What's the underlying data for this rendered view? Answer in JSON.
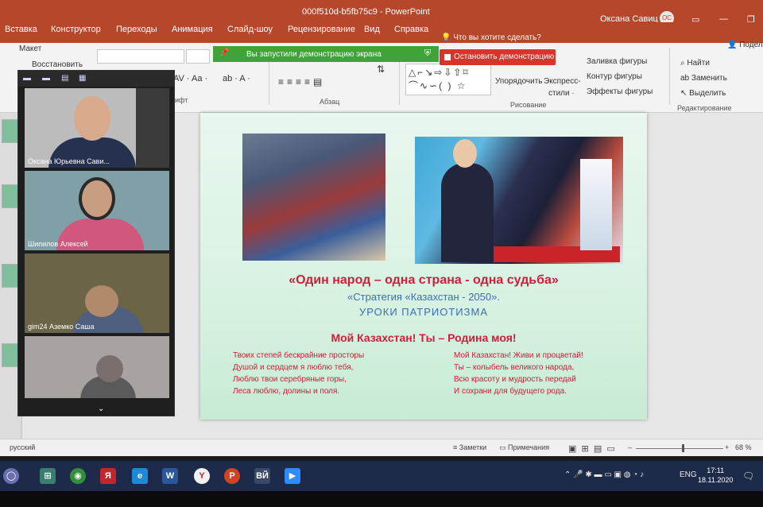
{
  "window": {
    "doc_title": "000f510d-b5fb75c9  -  PowerPoint",
    "user_name": "Оксана Савиц",
    "user_initials": "ОС"
  },
  "ribbon_tabs": [
    "Вставка",
    "Конструктор",
    "Переходы",
    "Анимация",
    "Слайд-шоу",
    "Рецензирование",
    "Вид",
    "Справка"
  ],
  "tell_me": "Что вы хотите сделать?",
  "share_label": "Подел",
  "ribbon": {
    "layout": "Макет",
    "restore": "Восстановить",
    "font_group": "рифт",
    "paragraph_group": "Абзац",
    "drawing_group": "Рисование",
    "editing_group": "Редактирование",
    "arrange": "Упорядочить",
    "quick_styles": "Экспресс-\nстили",
    "shape_fill": "Заливка фигуры",
    "shape_outline": "Контур фигуры",
    "shape_effects": "Эффекты фигуры",
    "find": "Найти",
    "replace": "Заменить",
    "select": "Выделить"
  },
  "screen_share": {
    "banner": "Вы запустили демонстрацию экрана",
    "stop_button": "Остановить демонстрацию"
  },
  "participants": [
    {
      "name": "Оксана Юрьевна Сави..."
    },
    {
      "name": "Шипилов Алексей"
    },
    {
      "name": "gim24 Аземко Саша"
    },
    {
      "name": ""
    }
  ],
  "slide": {
    "title": "«Один народ – одна страна - одна судьба»",
    "subtitle": "«Стратегия «Казахстан - 2050».",
    "subtitle2": "УРОКИ  ПАТРИОТИЗМА",
    "heading": "Мой Казахстан! Ты – Родина моя!",
    "poem_left": [
      "Твоих степей бескрайние просторы",
      "Душой и сердцем я люблю тебя,",
      "Люблю твои серебряные горы,",
      "Леса люблю, долины и поля."
    ],
    "poem_right": [
      "Мой Казахстан! Живи и процветай!",
      "Ты – колыбель великого народа,",
      "Всю красоту и мудрость передай",
      "И сохрани для будущего рода."
    ]
  },
  "status": {
    "language": "русский",
    "notes": "Заметки",
    "comments": "Примечания",
    "zoom": "68 %"
  },
  "taskbar": {
    "apps": [
      "⊞",
      "◉",
      "Я",
      "e",
      "W",
      "Y",
      "P",
      "ВЙ",
      "▶"
    ],
    "lang": "ENG",
    "time": "17:11",
    "date": "18.11.2020"
  },
  "colors": {
    "accent": "#b7472a",
    "share_green": "#3fa33a",
    "stop_red": "#d9342b",
    "slide_title": "#c9213a",
    "slide_sub": "#3b6eb3"
  }
}
